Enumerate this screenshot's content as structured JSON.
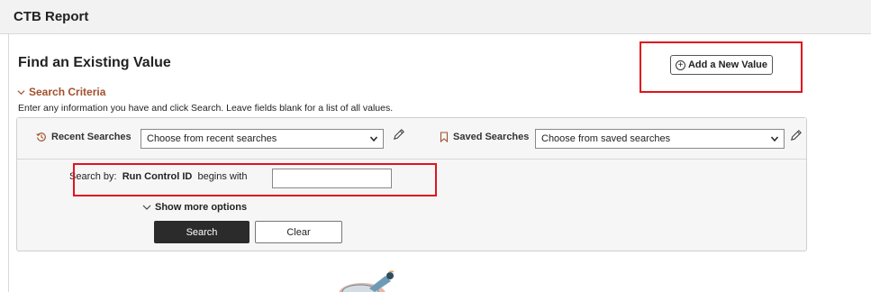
{
  "header": {
    "title": "CTB Report"
  },
  "main": {
    "section_title": "Find an Existing Value",
    "add_button_label": "Add a New Value",
    "criteria_toggle_label": "Search Criteria",
    "hint_text": "Enter any information you have and click Search. Leave fields blank for a list of all values."
  },
  "search_panel": {
    "recent_label": "Recent Searches",
    "recent_select_value": "Choose from recent searches",
    "saved_label": "Saved Searches",
    "saved_select_value": "Choose from saved searches",
    "search_by_label": "Search by:",
    "field_name": "Run Control ID",
    "operator": "begins with",
    "run_control_value": "",
    "more_options_label": "Show more options",
    "search_button_label": "Search",
    "clear_button_label": "Clear"
  },
  "icons": {
    "recent": "history-icon",
    "saved": "bookmark-icon",
    "edit": "pencil-icon",
    "add": "plus-circle-icon",
    "chevron": "chevron-down-icon"
  },
  "colors": {
    "highlight": "#e0141e",
    "criteria_link": "#a0522d",
    "primary_button": "#2b2b2b",
    "header_bg": "#f2f2f2"
  }
}
